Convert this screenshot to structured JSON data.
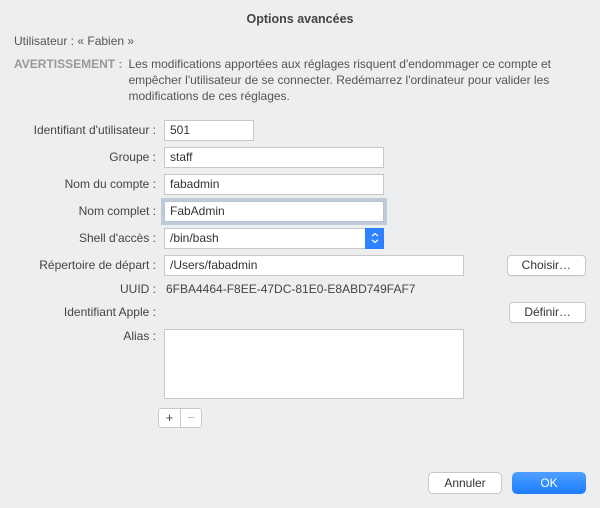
{
  "title": "Options avancées",
  "user_line_prefix": "Utilisateur :",
  "user_line_value": "« Fabien »",
  "warning_label": "AVERTISSEMENT :",
  "warning_text": "Les modifications apportées aux réglages risquent d'endommager ce compte et empêcher l'utilisateur de se connecter. Redémarrez l'ordinateur pour valider les modifications de ces réglages.",
  "labels": {
    "user_id": "Identifiant d'utilisateur :",
    "group": "Groupe :",
    "account_name": "Nom du compte :",
    "full_name": "Nom complet :",
    "login_shell": "Shell d'accès :",
    "home_dir": "Répertoire de départ :",
    "uuid": "UUID :",
    "apple_id": "Identifiant Apple :",
    "aliases": "Alias :"
  },
  "values": {
    "user_id": "501",
    "group": "staff",
    "account_name": "fabadmin",
    "full_name": "FabAdmin",
    "login_shell": "/bin/bash",
    "home_dir": "/Users/fabadmin",
    "uuid": "6FBA4464-F8EE-47DC-81E0-E8ABD749FAF7",
    "apple_id": ""
  },
  "buttons": {
    "choose": "Choisir…",
    "set": "Définir…",
    "cancel": "Annuler",
    "ok": "OK",
    "add": "+",
    "remove": "−"
  }
}
